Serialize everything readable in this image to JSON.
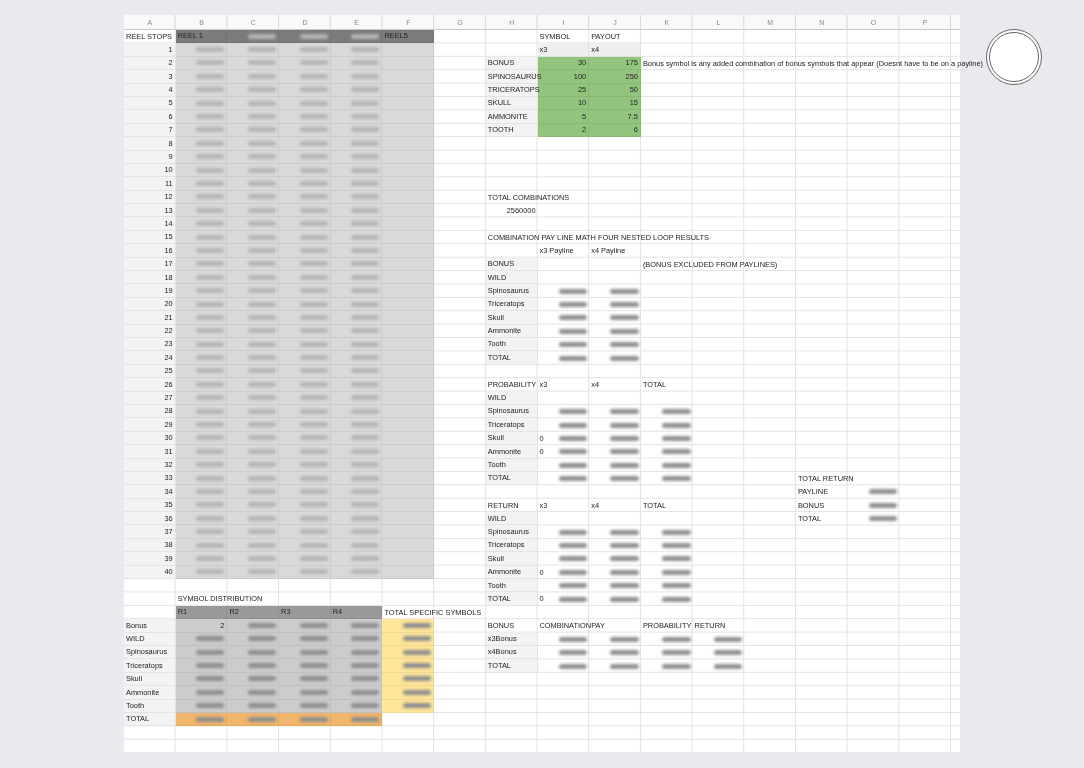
{
  "column_headers": [
    "A",
    "B",
    "C",
    "D",
    "E",
    "F",
    "G",
    "H",
    "I",
    "J",
    "K",
    "L",
    "M",
    "N",
    "O",
    "P"
  ],
  "reel_stops": {
    "title": "REEL STOPS",
    "reels": [
      {
        "label": "REEL 1",
        "blurred": false
      },
      {
        "blurred": true
      },
      {
        "blurred": true
      },
      {
        "blurred": true
      },
      {
        "label": "REEL5",
        "blurred": false
      }
    ],
    "stops": [
      "1",
      "2",
      "3",
      "4",
      "5",
      "6",
      "7",
      "8",
      "9",
      "10",
      "11",
      "12",
      "13",
      "14",
      "15",
      "16",
      "17",
      "18",
      "19",
      "20",
      "21",
      "22",
      "23",
      "24",
      "25",
      "26",
      "27",
      "28",
      "29",
      "30",
      "31",
      "32",
      "33",
      "34",
      "35",
      "36",
      "37",
      "38",
      "39",
      "40"
    ]
  },
  "payout_table": {
    "headers": [
      "SYMBOL",
      "PAYOUT"
    ],
    "subheaders": [
      "x3",
      "x4"
    ],
    "note": "Bonus symbol is any added combination of bonus symbols that appear (Doesnt have to be on a payline)",
    "rows": [
      {
        "symbol": "BONUS",
        "x3": "30",
        "x4": "175"
      },
      {
        "symbol": "SPINOSAURUS",
        "x3": "100",
        "x4": "250"
      },
      {
        "symbol": "TRICERATOPS",
        "x3": "25",
        "x4": "50"
      },
      {
        "symbol": "SKULL",
        "x3": "10",
        "x4": "15"
      },
      {
        "symbol": "AMMONITE",
        "x3": "5",
        "x4": "7.5"
      },
      {
        "symbol": "TOOTH",
        "x3": "2",
        "x4": "6"
      }
    ]
  },
  "total_combinations": {
    "label": "TOTAL COMBINATIONS",
    "value": "2560000"
  },
  "payline_results": {
    "title": "COMBINATION PAY LINE MATH FOUR NESTED LOOP RESULTS",
    "columns": [
      "x3 Payline",
      "x4 Payline"
    ],
    "rows": [
      {
        "label": "BONUS",
        "note": "(BONUS EXCLUDED FROM PAYLINES)",
        "blurred": false
      },
      {
        "label": "WILD",
        "blurred": false
      },
      {
        "label": "Spinosaurus",
        "blurred": true
      },
      {
        "label": "Triceratops",
        "blurred": true
      },
      {
        "label": "Skull",
        "blurred": true
      },
      {
        "label": "Ammonite",
        "blurred": true
      },
      {
        "label": "Tooth",
        "blurred": true
      },
      {
        "label": "TOTAL",
        "blurred": true
      }
    ]
  },
  "probability": {
    "title": "PROBABILITY",
    "columns": [
      "x3",
      "x4",
      "TOTAL"
    ],
    "rows": [
      {
        "label": "WILD",
        "blurred": false
      },
      {
        "label": "Spinosaurus",
        "blurred": true
      },
      {
        "label": "Triceratops",
        "blurred": true
      },
      {
        "label": "Skull",
        "blurred": true,
        "x3_lead": "0"
      },
      {
        "label": "Ammonite",
        "blurred": true,
        "x3_lead": "0"
      },
      {
        "label": "Tooth",
        "blurred": true
      },
      {
        "label": "TOTAL",
        "blurred": true
      }
    ]
  },
  "return": {
    "title": "RETURN",
    "columns": [
      "x3",
      "x4",
      "TOTAL"
    ],
    "rows": [
      {
        "label": "WILD",
        "blurred": false
      },
      {
        "label": "Spinosaurus",
        "blurred": true
      },
      {
        "label": "Triceratops",
        "blurred": true
      },
      {
        "label": "Skull",
        "blurred": true
      },
      {
        "label": "Ammonite",
        "blurred": true,
        "x3_lead": "0"
      },
      {
        "label": "Tooth",
        "blurred": true
      },
      {
        "label": "TOTAL",
        "blurred": true,
        "x3_lead": "0"
      }
    ]
  },
  "total_return": {
    "title": "TOTAL RETURN",
    "rows": [
      {
        "label": "PAYLINE",
        "blurred": true
      },
      {
        "label": "BONUS",
        "blurred": true
      },
      {
        "label": "TOTAL",
        "blurred": true
      }
    ]
  },
  "symbol_distribution": {
    "title": "SYMBOL DISTRIBUTION",
    "reels": [
      "R1",
      "R2",
      "R3",
      "R4"
    ],
    "total_label": "TOTAL SPECIFIC SYMBOLS",
    "rows": [
      {
        "label": "Bonus",
        "r1": "2"
      },
      {
        "label": "WILD"
      },
      {
        "label": "Spinosaurus"
      },
      {
        "label": "Triceratops"
      },
      {
        "label": "Skull"
      },
      {
        "label": "Ammonite"
      },
      {
        "label": "Tooth"
      }
    ],
    "total_row": "TOTAL"
  },
  "bonus": {
    "headers": [
      "BONUS",
      "COMBINATION",
      "PAY",
      "PROBABILITY",
      "RETURN"
    ],
    "rows": [
      {
        "label": "x3Bonus",
        "blurred": true
      },
      {
        "label": "x4Bonus",
        "blurred": true
      },
      {
        "label": "TOTAL",
        "blurred": true
      }
    ]
  }
}
